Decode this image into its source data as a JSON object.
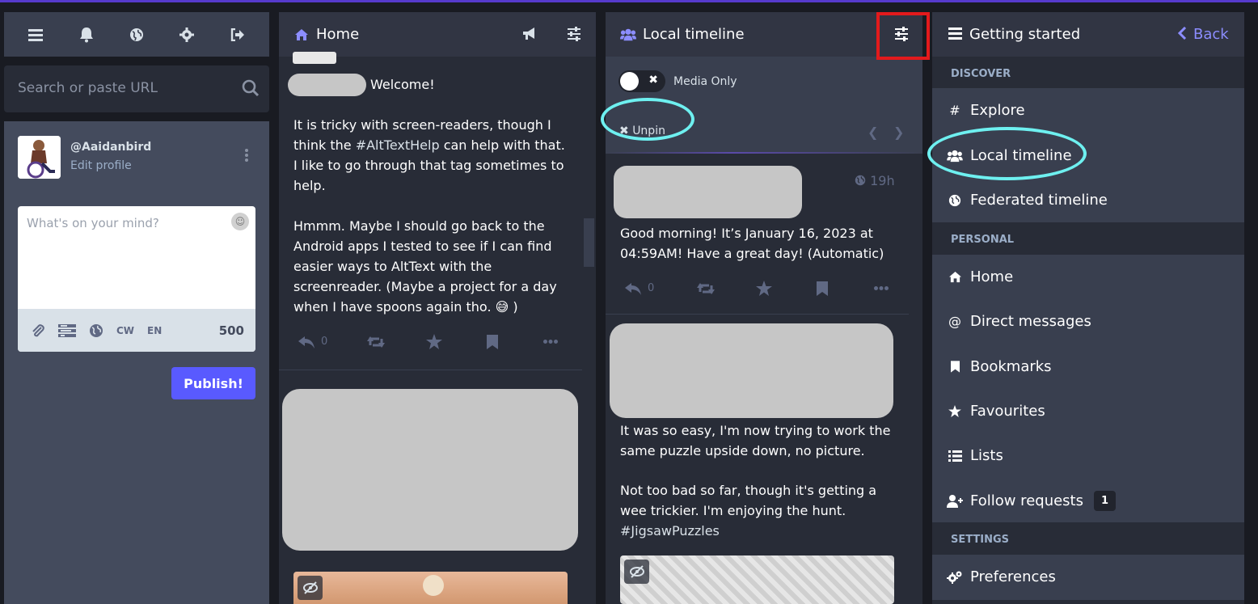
{
  "nav_bar": {
    "icons": [
      "menu-icon",
      "bell-icon",
      "globe-icon",
      "gear-icon",
      "logout-icon"
    ]
  },
  "search": {
    "placeholder": "Search or paste URL"
  },
  "profile": {
    "handle": "@Aaidanbird",
    "edit_label": "Edit profile"
  },
  "composer": {
    "placeholder": "What's on your mind?",
    "cw_label": "CW",
    "lang_label": "EN",
    "char_count": "500",
    "publish_label": "Publish!"
  },
  "home_column": {
    "title": "Home",
    "post1": {
      "lead": "Welcome!",
      "para1_a": "It is tricky with screen-readers, though I think the ",
      "para1_tag": "#AltTextHelp",
      "para1_b": " can help with that. I like to go through that tag sometimes to help.",
      "para2": "Hmmm. Maybe I should go back to the Android apps I tested to see if I can find easier ways to AltText with the screenreader. (Maybe a project for a day when I have spoons again tho. 😅 )",
      "reply_count": "0"
    }
  },
  "local_column": {
    "title": "Local timeline",
    "media_only_label": "Media Only",
    "unpin_label": "Unpin",
    "post1": {
      "time": "19h",
      "text": "Good morning! It’s January 16, 2023 at 04:59AM! Have a great day! (Automatic)",
      "reply_count": "0"
    },
    "post2": {
      "para1": "It was so easy, I'm now trying to work the same puzzle upside down, no picture.",
      "para2": "Not too bad so far, though it's getting a wee trickier. I'm enjoying the hunt.",
      "tag": "#JigsawPuzzles"
    }
  },
  "getting_started": {
    "title": "Getting started",
    "back_label": "Back",
    "sections": {
      "discover": "DISCOVER",
      "personal": "PERSONAL",
      "settings": "SETTINGS"
    },
    "items": {
      "explore": "Explore",
      "local_timeline": "Local timeline",
      "federated_timeline": "Federated timeline",
      "home": "Home",
      "direct_messages": "Direct messages",
      "bookmarks": "Bookmarks",
      "favourites": "Favourites",
      "lists": "Lists",
      "follow_requests": "Follow requests",
      "follow_requests_count": "1",
      "preferences": "Preferences"
    }
  },
  "colors": {
    "accent": "#595aff",
    "highlight_ring": "#6ef0f0",
    "annotation_box": "#e31a1c",
    "header_icon": "#8c8dff",
    "back_link": "#8c8dff"
  }
}
